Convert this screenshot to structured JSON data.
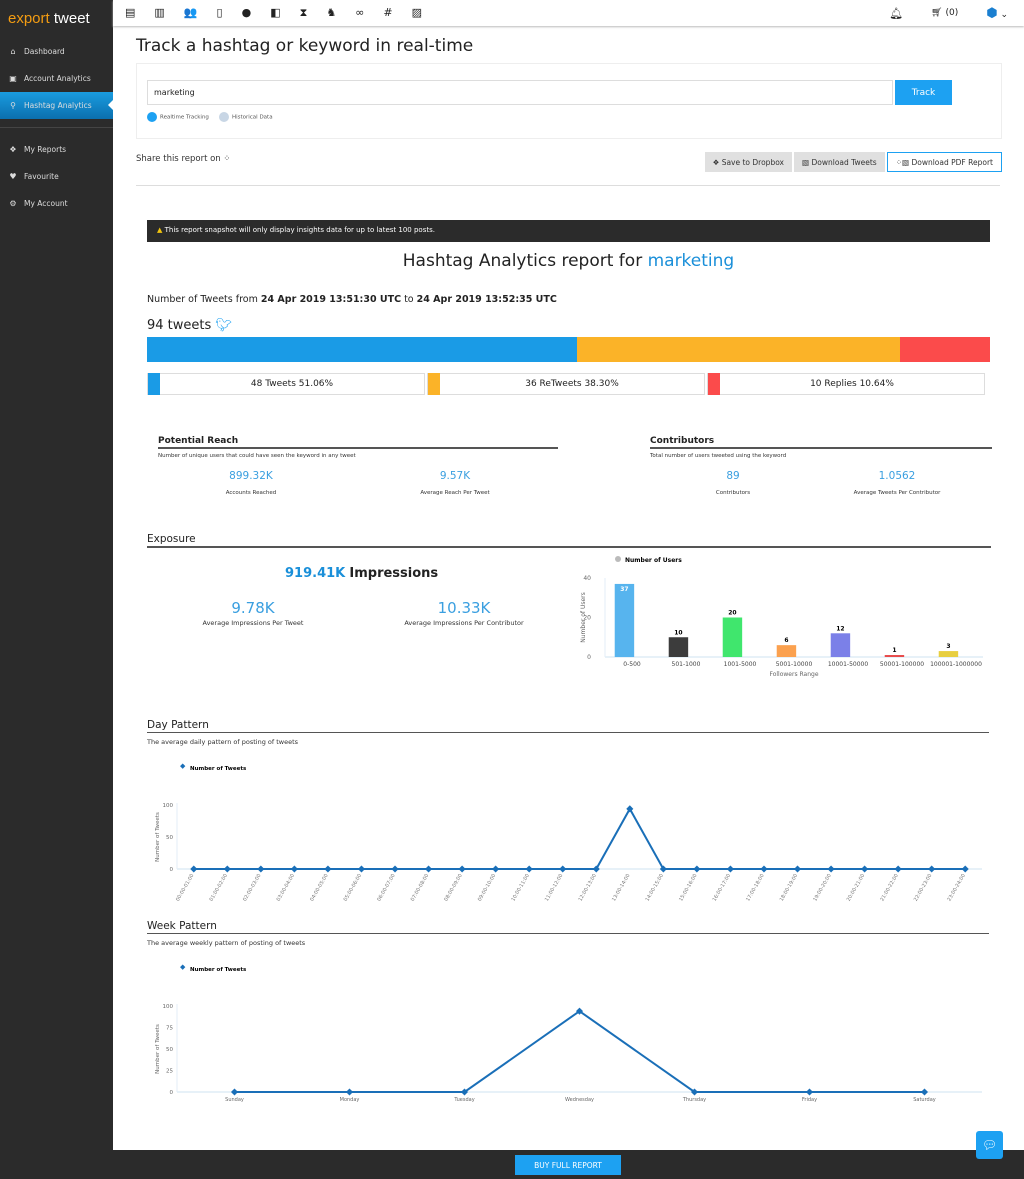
{
  "app": {
    "logo_a": "export",
    "logo_b": "tweet"
  },
  "sidebar": {
    "items": [
      {
        "label": "Dashboard",
        "icon": "home-icon"
      },
      {
        "label": "Account Analytics",
        "icon": "account-icon"
      },
      {
        "label": "Hashtag Analytics",
        "icon": "search-icon",
        "active": true
      },
      {
        "label": "My Reports",
        "icon": "reports-icon"
      },
      {
        "label": "Favourite",
        "icon": "heart-icon"
      },
      {
        "label": "My Account",
        "icon": "gear-icon"
      }
    ]
  },
  "topbar": {
    "cart": "(0)"
  },
  "page": {
    "title": "Track a hashtag or keyword in real-time",
    "search_value": "marketing",
    "track": "Track",
    "realtime": "Realtime Tracking",
    "historical": "Historical Data",
    "share": "Share this report on",
    "save_dropbox": "Save to Dropbox",
    "download_tweets": "Download Tweets",
    "download_pdf": "Download PDF Report"
  },
  "report": {
    "notice": "This report snapshot will only display insights data for up to latest 100 posts.",
    "title": "Hashtag Analytics report for",
    "keyword": "marketing",
    "range_prefix": "Number of Tweets from",
    "from": "24 Apr 2019 13:51:30 UTC",
    "to_word": "to",
    "to": "24 Apr 2019 13:52:35 UTC",
    "total": "94 tweets",
    "split": [
      {
        "label": "48 Tweets 51.06%",
        "pct": 51.06,
        "color": "#1a9be6"
      },
      {
        "label": "36 ReTweets 38.30%",
        "pct": 38.3,
        "color": "#fbb328"
      },
      {
        "label": "10 Replies 10.64%",
        "pct": 10.64,
        "color": "#fb4b4b"
      }
    ]
  },
  "reach": {
    "title": "Potential Reach",
    "sub": "Number of unique users that could have seen the keyword in any tweet",
    "stats": [
      {
        "v": "899.32K",
        "l": "Accounts Reached"
      },
      {
        "v": "9.57K",
        "l": "Average Reach Per Tweet"
      }
    ]
  },
  "contributors": {
    "title": "Contributors",
    "sub": "Total number of users tweeted using the keyword",
    "stats": [
      {
        "v": "89",
        "l": "Contributors"
      },
      {
        "v": "1.0562",
        "l": "Average Tweets Per Contributor"
      }
    ]
  },
  "exposure": {
    "title": "Exposure",
    "impressions_value": "919.41K",
    "impressions_label": "Impressions",
    "stats": [
      {
        "v": "9.78K",
        "l": "Average Impressions Per Tweet"
      },
      {
        "v": "10.33K",
        "l": "Average Impressions Per Contributor"
      }
    ]
  },
  "day": {
    "title": "Day Pattern",
    "sub": "The average daily pattern of posting of tweets"
  },
  "week": {
    "title": "Week Pattern",
    "sub": "The average weekly pattern of posting of tweets"
  },
  "footer": {
    "buy": "BUY FULL REPORT"
  },
  "chart_data": [
    {
      "type": "bar",
      "legend": "Number of Users",
      "xlabel": "Followers Range",
      "ylabel": "Number of Users",
      "ylim": [
        0,
        40
      ],
      "yticks": [
        0,
        20,
        40
      ],
      "categories": [
        "0-500",
        "501-1000",
        "1001-5000",
        "5001-10000",
        "10001-50000",
        "50001-100000",
        "100001-1000000"
      ],
      "values": [
        37,
        10,
        20,
        6,
        12,
        1,
        3
      ],
      "colors": [
        "#57b4ee",
        "#3c3c3c",
        "#40e66d",
        "#fba14f",
        "#7b80e8",
        "#e84b4b",
        "#e8cf40"
      ]
    },
    {
      "type": "line",
      "legend": "Number of Tweets",
      "ylabel": "Number of Tweets",
      "ylim": [
        0,
        100
      ],
      "yticks": [
        0,
        50,
        100
      ],
      "categories": [
        "00:00-01:00",
        "01:00-02:00",
        "02:00-03:00",
        "03:00-04:00",
        "04:00-05:00",
        "05:00-06:00",
        "06:00-07:00",
        "07:00-08:00",
        "08:00-09:00",
        "09:00-10:00",
        "10:00-11:00",
        "11:00-12:00",
        "12:00-13:00",
        "13:00-14:00",
        "14:00-15:00",
        "15:00-16:00",
        "16:00-17:00",
        "17:00-18:00",
        "18:00-19:00",
        "19:00-20:00",
        "20:00-21:00",
        "21:00-22:00",
        "22:00-23:00",
        "23:00-24:00"
      ],
      "values": [
        0,
        0,
        0,
        0,
        0,
        0,
        0,
        0,
        0,
        0,
        0,
        0,
        0,
        94,
        0,
        0,
        0,
        0,
        0,
        0,
        0,
        0,
        0,
        0
      ]
    },
    {
      "type": "line",
      "legend": "Number of Tweets",
      "ylabel": "Number of Tweets",
      "ylim": [
        0,
        100
      ],
      "yticks": [
        0,
        25,
        50,
        75,
        100
      ],
      "categories": [
        "Sunday",
        "Monday",
        "Tuesday",
        "Wednesday",
        "Thursday",
        "Friday",
        "Saturday"
      ],
      "values": [
        0,
        0,
        0,
        94,
        0,
        0,
        0
      ]
    }
  ]
}
